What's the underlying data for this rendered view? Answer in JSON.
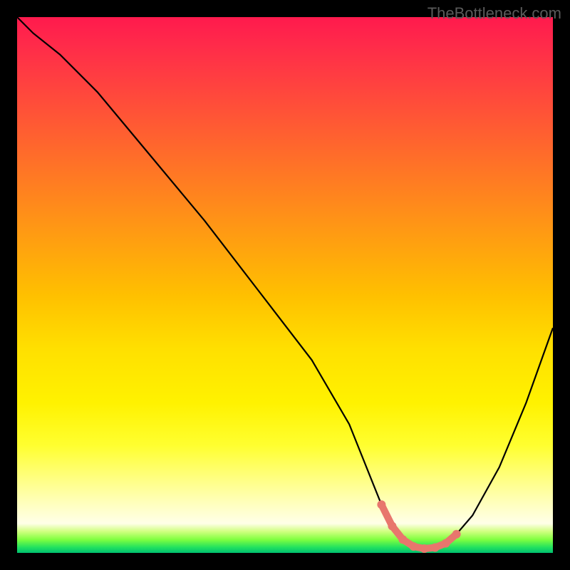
{
  "watermark": "TheBottleneck.com",
  "chart_data": {
    "type": "line",
    "title": "",
    "xlabel": "",
    "ylabel": "",
    "x_range": [
      0,
      100
    ],
    "y_range": [
      0,
      100
    ],
    "curve": {
      "x": [
        0,
        3,
        8,
        15,
        25,
        35,
        45,
        55,
        62,
        66,
        68,
        70,
        72,
        74,
        76,
        78,
        80,
        82,
        85,
        90,
        95,
        100
      ],
      "y": [
        100,
        97,
        93,
        86,
        74,
        62,
        49,
        36,
        24,
        14,
        9,
        5,
        2.5,
        1.2,
        0.8,
        1.0,
        1.8,
        3.5,
        7,
        16,
        28,
        42
      ]
    },
    "marker_region": {
      "x": [
        68,
        70,
        72,
        74,
        76,
        78,
        80,
        82
      ],
      "y": [
        9,
        5,
        2.5,
        1.2,
        0.8,
        1.0,
        1.8,
        3.5
      ]
    },
    "gradient_stops": [
      {
        "pos": 0,
        "color": "#ff1a4d"
      },
      {
        "pos": 0.5,
        "color": "#ffc000"
      },
      {
        "pos": 0.95,
        "color": "#ffffe8"
      },
      {
        "pos": 1.0,
        "color": "#00c070"
      }
    ]
  }
}
